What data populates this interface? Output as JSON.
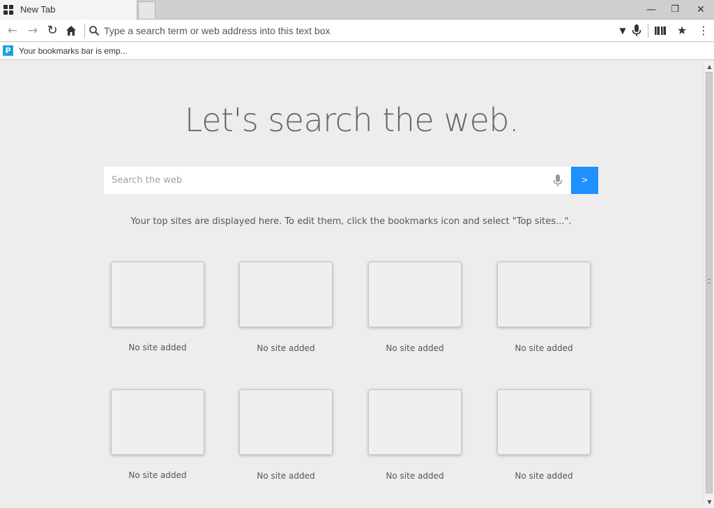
{
  "tab": {
    "title": "New Tab"
  },
  "window_controls": {
    "minimize": "—",
    "restore": "❐",
    "close": "✕"
  },
  "navbar": {
    "address_placeholder": "Type a search term or web address into this text box"
  },
  "bookmarks_bar": {
    "text": "Your bookmarks bar is emp..."
  },
  "page": {
    "headline": "Let's search the web.",
    "search_placeholder": "Search the web",
    "search_button": ">",
    "hint": "Your top sites are displayed here. To edit them, click the bookmarks icon and select \"Top sites...\"."
  },
  "top_sites": [
    {
      "label": "No site added"
    },
    {
      "label": "No site added"
    },
    {
      "label": "No site added"
    },
    {
      "label": "No site added"
    },
    {
      "label": "No site added"
    },
    {
      "label": "No site added"
    },
    {
      "label": "No site added"
    },
    {
      "label": "No site added"
    }
  ],
  "colors": {
    "accent": "#1e90ff",
    "bookmark_icon": "#1ba1e2",
    "page_bg": "#ededed"
  },
  "icons": [
    "apps-grid-icon",
    "back-arrow-icon",
    "forward-arrow-icon",
    "reload-icon",
    "home-icon",
    "search-icon",
    "dropdown-icon",
    "microphone-icon",
    "reading-view-icon",
    "star-icon",
    "menu-icon"
  ]
}
